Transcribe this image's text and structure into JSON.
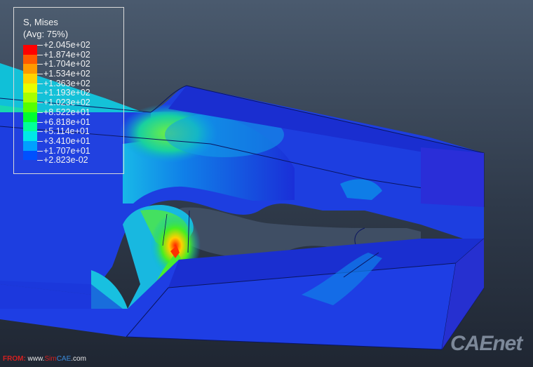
{
  "legend": {
    "title": "S, Mises",
    "subtitle": "(Avg: 75%)",
    "labels": [
      "+2.045e+02",
      "+1.874e+02",
      "+1.704e+02",
      "+1.534e+02",
      "+1.363e+02",
      "+1.193e+02",
      "+1.023e+02",
      "+8.522e+01",
      "+6.818e+01",
      "+5.114e+01",
      "+3.410e+01",
      "+1.707e+01",
      "+2.823e-02"
    ],
    "colors": [
      "#ff0000",
      "#ff5a00",
      "#ff9a00",
      "#ffd400",
      "#e8ff00",
      "#a6ff00",
      "#55ff00",
      "#00ff30",
      "#00ff9a",
      "#00e8e8",
      "#00a0ff",
      "#0050ff",
      "#0000e8"
    ]
  },
  "footer": {
    "from": "FROM:",
    "www": " www.",
    "sim": "Sim",
    "cae": "CAE",
    "com": ".com"
  },
  "watermark": "CAEnet"
}
